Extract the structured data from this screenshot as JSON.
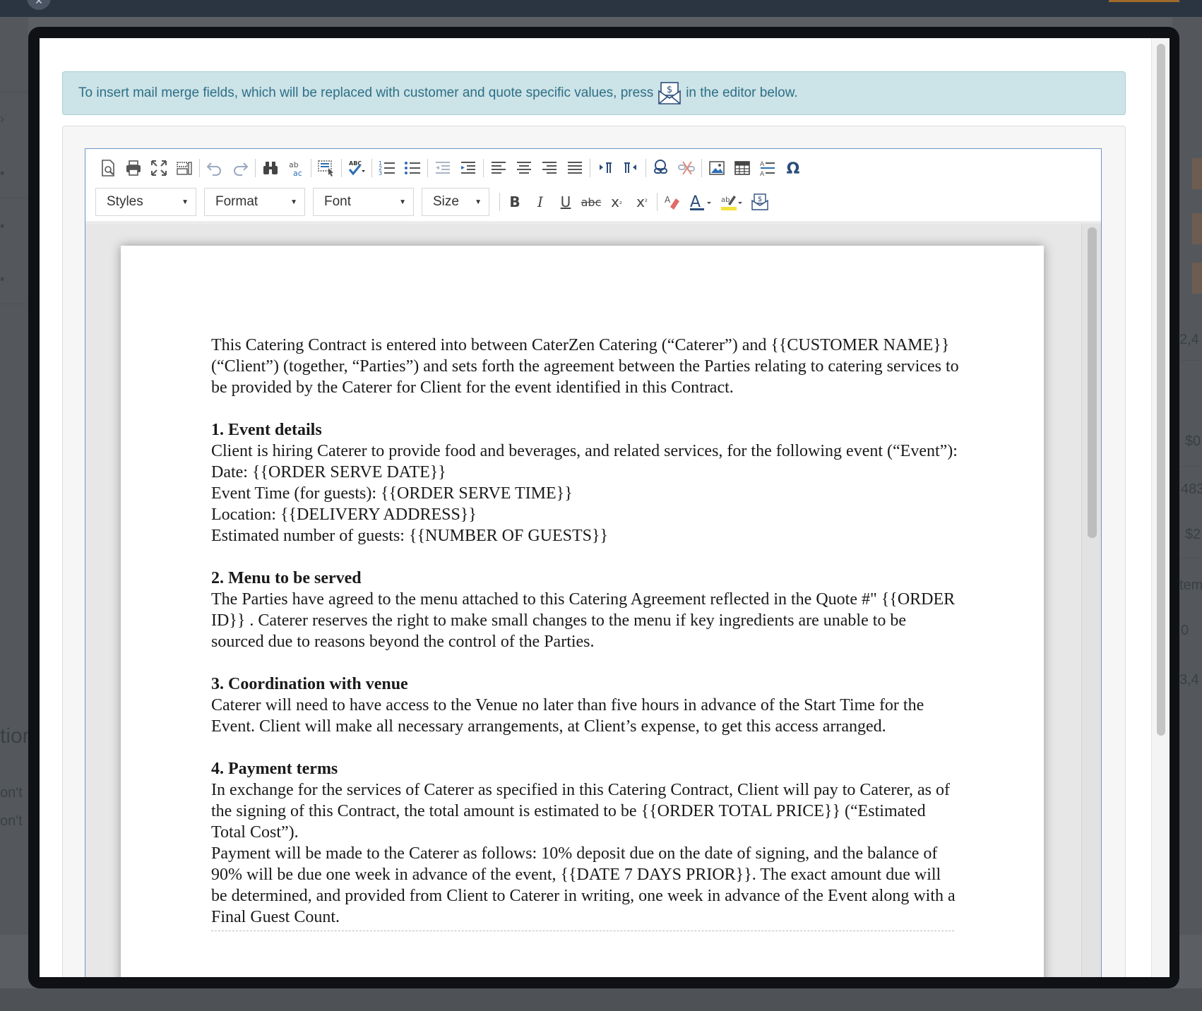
{
  "background": {
    "right_fragments": [
      "2,4",
      "$0",
      "483",
      "$2",
      "tem",
      "0",
      "3,4"
    ],
    "left_fragments": [
      "tion",
      "on't",
      "on't"
    ]
  },
  "alert": {
    "text_before": "To insert mail merge fields, which will be replaced with customer and quote specific values, press",
    "text_after": "in the editor below."
  },
  "toolbar": {
    "row1": [
      "preview-icon",
      "print-icon",
      "maximize-icon",
      "show-blocks-icon",
      "undo-icon",
      "redo-icon",
      "find-icon",
      "replace-icon",
      "select-all-icon",
      "spellcheck-icon",
      "numbered-list-icon",
      "bulleted-list-icon",
      "decrease-indent-icon",
      "increase-indent-icon",
      "align-left-icon",
      "align-center-icon",
      "align-right-icon",
      "justify-icon",
      "ltr-icon",
      "rtl-icon",
      "link-icon",
      "unlink-icon",
      "image-icon",
      "table-icon",
      "horizontal-rule-icon",
      "special-char-icon"
    ],
    "styles_label": "Styles",
    "format_label": "Format",
    "font_label": "Font",
    "size_label": "Size",
    "bold": "B",
    "italic": "I",
    "underline": "U",
    "strike": "abc",
    "subscript": "x",
    "superscript": "x"
  },
  "document": {
    "intro": "This Catering Contract is entered into between CaterZen Catering (“Caterer”) and {{CUSTOMER NAME}} (“Client”) (together, “Parties”) and sets forth the agreement between the Parties relating to catering services to be provided by the Caterer for Client for the event identified in this Contract.",
    "s1_title": "1.  Event details",
    "s1_body": "Client is hiring Caterer to provide food and beverages, and related services, for the following event (“Event”):",
    "s1_date": "Date: {{ORDER SERVE DATE}}",
    "s1_time": "Event Time (for guests): {{ORDER SERVE TIME}}",
    "s1_location": "Location: {{DELIVERY ADDRESS}}",
    "s1_guests": "Estimated number of guests: {{NUMBER OF GUESTS}}",
    "s2_title": "2.  Menu to be served",
    "s2_body": "The Parties have agreed to the menu attached to this Catering Agreement reflected in the Quote #\" {{ORDER ID}} .  Caterer reserves the right to make small changes to the menu if key ingredients are unable to be sourced due to reasons beyond the control of the Parties.",
    "s3_title": "3.  Coordination with venue",
    "s3_body": "Caterer will need to have access to the Venue no later than five hours in advance of the Start Time for the Event.  Client will make all necessary arrangements, at Client’s expense, to get this access arranged.",
    "s4_title": "4.  Payment terms",
    "s4_body1": "In exchange for the services of Caterer as specified in this Catering Contract, Client will pay to Caterer, as of the signing of this Contract, the total amount is estimated to be {{ORDER TOTAL PRICE}} (“Estimated Total Cost”).",
    "s4_body2": "Payment will be made to the Caterer as follows:  10% deposit due on the date of signing, and the balance of 90%  will be due one week in advance of the event, {{DATE 7 DAYS PRIOR}}.  The exact amount due will be determined, and provided from Client to Caterer in writing, one week in advance of the Event along with a Final Guest Count."
  },
  "colors": {
    "alert_bg": "#cce3e7",
    "alert_text": "#2d6f86",
    "editor_border": "#6f94c8",
    "icon_blue": "#2a6eb5"
  }
}
